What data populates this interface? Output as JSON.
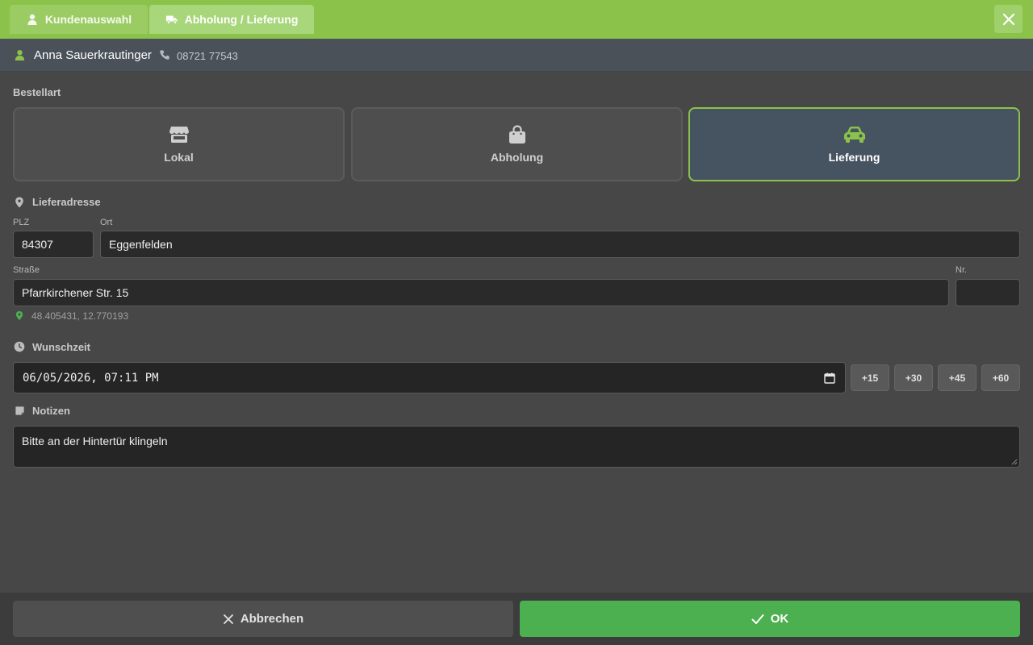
{
  "tabs": [
    {
      "label": "Kundenauswahl",
      "icon": "user-icon"
    },
    {
      "label": "Abholung / Lieferung",
      "icon": "truck-icon"
    }
  ],
  "customer": {
    "name": "Anna Sauerkrautinger",
    "phone": "08721 77543"
  },
  "order_type": {
    "label": "Bestellart",
    "options": [
      {
        "label": "Lokal",
        "icon": "store-icon"
      },
      {
        "label": "Abholung",
        "icon": "shopping-bag-icon"
      },
      {
        "label": "Lieferung",
        "icon": "car-icon",
        "selected": true
      }
    ]
  },
  "address": {
    "label": "Lieferadresse",
    "plz_label": "PLZ",
    "plz": "84307",
    "ort_label": "Ort",
    "ort": "Eggenfelden",
    "street_label": "Straße",
    "street": "Pfarrkirchener Str. 15",
    "nr_label": "Nr.",
    "nr": "",
    "coords": "48.405431, 12.770193"
  },
  "time": {
    "label": "Wunschzeit",
    "value": "06/05/2026, 07:11 PM",
    "quick": [
      "+15",
      "+30",
      "+45",
      "+60"
    ]
  },
  "notes": {
    "label": "Notizen",
    "value": "Bitte an der Hintertür klingeln"
  },
  "footer": {
    "cancel": "Abbrechen",
    "ok": "OK"
  },
  "colors": {
    "accent": "#8bc34a",
    "ok": "#4caf50",
    "selected_bg": "#465361"
  }
}
